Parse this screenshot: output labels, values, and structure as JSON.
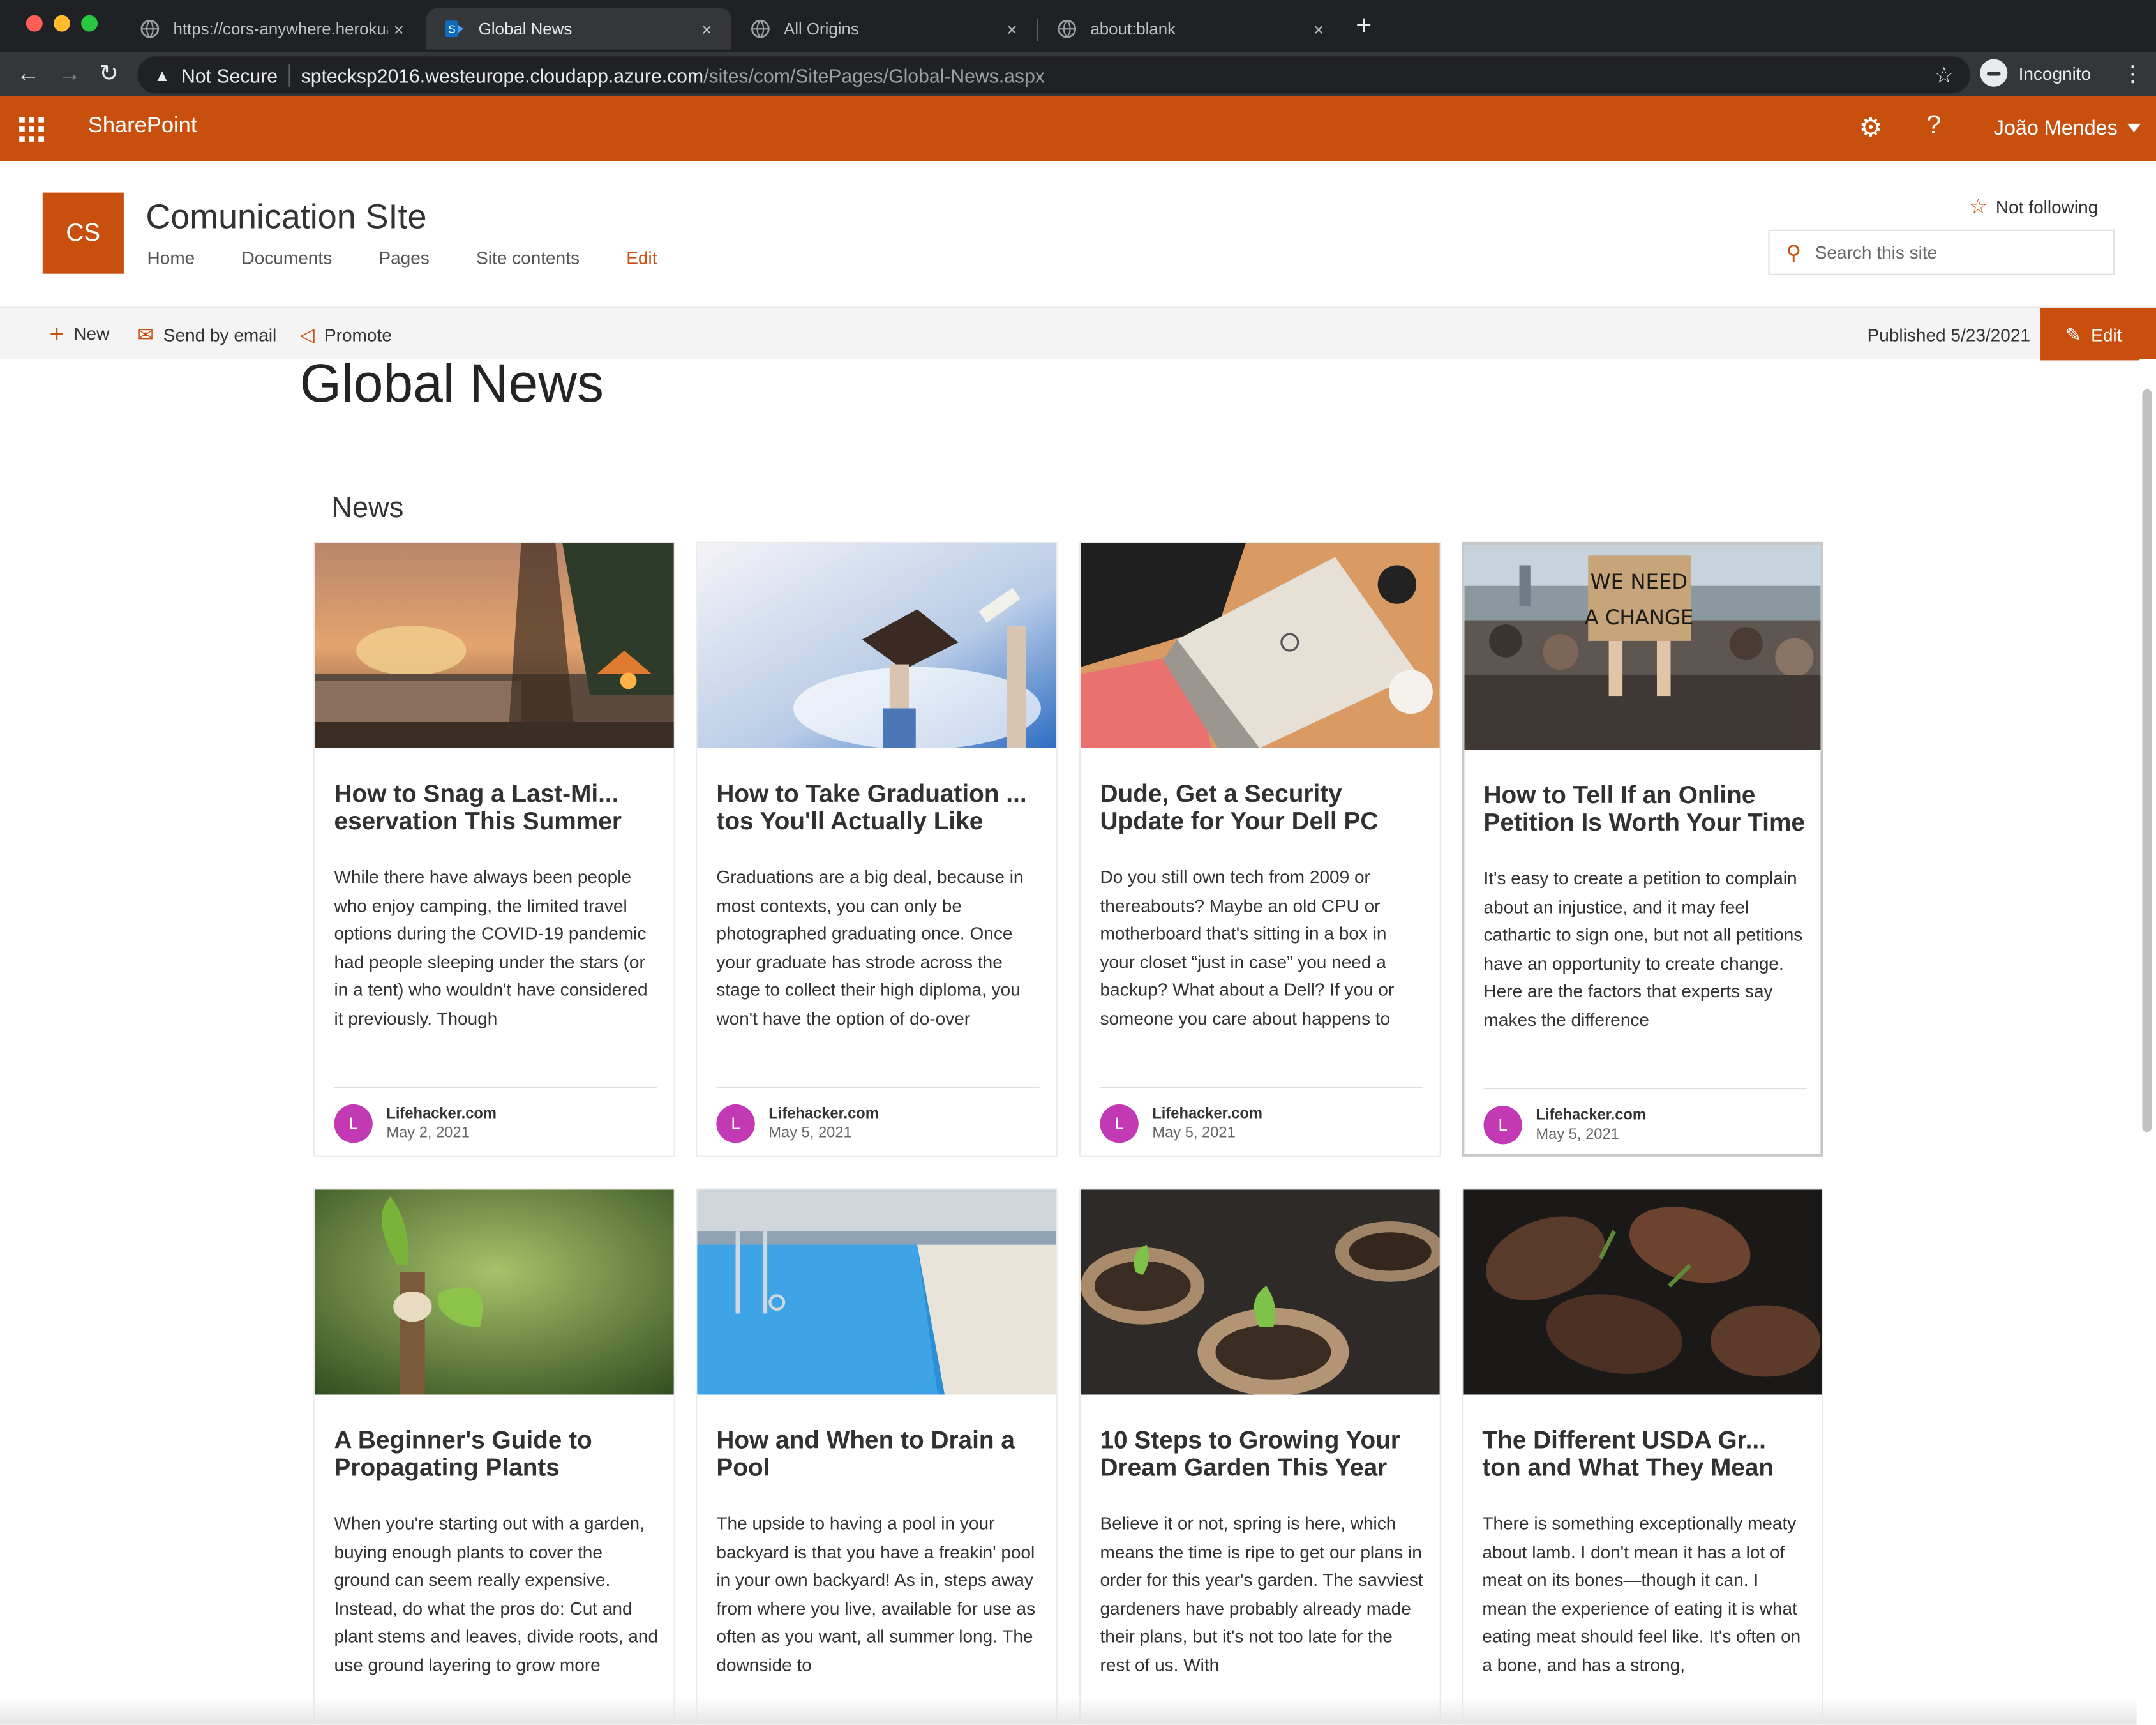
{
  "browser": {
    "tabs": [
      {
        "title": "https://cors-anywhere.herokua",
        "close": "×"
      },
      {
        "title": "Global News",
        "close": "×"
      },
      {
        "title": "All Origins",
        "close": "×"
      },
      {
        "title": "about:blank",
        "close": "×"
      }
    ],
    "new_tab": "+",
    "back": "←",
    "forward": "→",
    "reload": "↻",
    "security_label": "Not Secure",
    "url_host": "sptecksp2016.westeurope.cloudapp.azure.com",
    "url_path": "/sites/com/SitePages/Global-News.aspx",
    "bookmark_icon": "☆",
    "profile_label": "Incognito",
    "menu_icon": "⋮"
  },
  "suite_bar": {
    "app_name": "SharePoint",
    "settings_icon": "⚙",
    "help_icon": "?",
    "user_name": "João Mendes"
  },
  "site": {
    "logo_text": "CS",
    "name": "Comunication SIte",
    "nav": [
      "Home",
      "Documents",
      "Pages",
      "Site contents"
    ],
    "nav_edit": "Edit",
    "follow_label": "Not following",
    "search_placeholder": "Search this site"
  },
  "command_bar": {
    "new_label": "New",
    "send_label": "Send by email",
    "promote_label": "Promote",
    "published": "Published 5/23/2021",
    "edit_label": "Edit"
  },
  "page": {
    "title": "Global News",
    "news_heading": "News"
  },
  "cards": [
    {
      "title": "How to Snag a Last-Mi... eservation This Summer",
      "desc": "While there have always been people who enjoy camping, the limited travel options during the COVID-19 pandemic had people sleeping under the stars (or in a tent) who wouldn't have considered it previously. Though",
      "avatar": "L",
      "source": "Lifehacker.com",
      "date": "May 2, 2021"
    },
    {
      "title": "How to Take Graduation ... tos You'll Actually Like",
      "desc": "Graduations are a big deal, because in most contexts, you can only be photographed graduating once. Once your graduate has strode across the stage to collect their high diploma, you won't have the option of do-over",
      "avatar": "L",
      "source": "Lifehacker.com",
      "date": "May 5, 2021"
    },
    {
      "title": "Dude, Get a Security Update for Your Dell PC",
      "desc": "Do you still own tech from 2009 or thereabouts? Maybe an old CPU or motherboard that's sitting in a box in your closet “just in case” you need a backup? What about a Dell? If you or someone you care about happens to",
      "avatar": "L",
      "source": "Lifehacker.com",
      "date": "May 5, 2021"
    },
    {
      "title": "How to Tell If an Online Petition Is Worth Your Time",
      "desc": "It's easy to create a petition to complain about an injustice, and it may feel cathartic to sign one, but not all petitions have an opportunity to create change. Here are the factors that experts say makes the difference",
      "avatar": "L",
      "source": "Lifehacker.com",
      "date": "May 5, 2021",
      "sign_line1": "WE NEED",
      "sign_line2": "A CHANGE"
    },
    {
      "title": "A Beginner's Guide to Propagating Plants",
      "desc": "When you're starting out with a garden, buying enough plants to cover the ground can seem really expensive. Instead, do what the pros do: Cut and plant stems and leaves, divide roots, and use ground layering to grow more",
      "avatar": "",
      "source": "",
      "date": ""
    },
    {
      "title": "How and When to Drain a Pool",
      "desc": "The upside to having a pool in your backyard is that you have a freakin' pool in your own backyard! As in, steps away from where you live, available for use as often as you want, all summer long. The downside to",
      "avatar": "",
      "source": "",
      "date": ""
    },
    {
      "title": "10 Steps to Growing Your Dream Garden This Year",
      "desc": "Believe it or not, spring is here, which means the time is ripe to get our plans in order for this year's garden. The savviest gardeners have probably already made their plans, but it's not too late for the rest of us. With",
      "avatar": "",
      "source": "",
      "date": ""
    },
    {
      "title": "The Different USDA Gr... ton and What They Mean",
      "desc": "There is something exceptionally meaty about lamb. I don't mean it has a lot of meat on its bones—though it can. I mean the experience of eating it is what eating meat should feel like. It's often on a bone, and has a strong,",
      "avatar": "",
      "source": "",
      "date": ""
    }
  ]
}
